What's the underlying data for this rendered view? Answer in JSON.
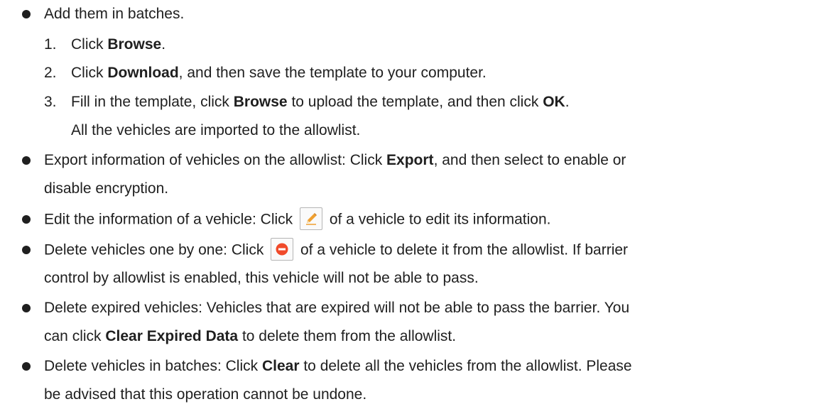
{
  "section": {
    "batch": {
      "intro": "Add them in batches.",
      "steps": [
        {
          "num": "1.",
          "pre": "Click ",
          "bold": "Browse",
          "post": "."
        },
        {
          "num": "2.",
          "pre": "Click ",
          "bold": "Download",
          "post": ", and then save the template to your computer."
        },
        {
          "num": "3.",
          "pre": "Fill in the template, click ",
          "bold": "Browse",
          "mid": " to upload the template, and then click ",
          "bold2": "OK",
          "post": "."
        }
      ],
      "step3_result": "All the vehicles are imported to the allowlist."
    },
    "export": {
      "pre": "Export information of vehicles on the allowlist: Click ",
      "bold": "Export",
      "post": ", and then select to enable or",
      "cont": "disable encryption."
    },
    "edit": {
      "pre": "Edit the information of a vehicle: Click ",
      "icon": "pencil-icon",
      "post": " of a vehicle to edit its information."
    },
    "delete_one": {
      "pre": "Delete vehicles one by one: Click ",
      "icon": "delete-icon",
      "post": " of a vehicle to delete it from the allowlist. If barrier",
      "cont": "control by allowlist is enabled, this vehicle will not be able to pass."
    },
    "delete_expired": {
      "line1": "Delete expired vehicles: Vehicles that are expired will not be able to pass the barrier. You",
      "pre": "can click ",
      "bold": "Clear Expired Data",
      "post": " to delete them from the allowlist."
    },
    "delete_batch": {
      "pre": "Delete vehicles in batches: Click ",
      "bold": "Clear",
      "post": " to delete all the vehicles from the allowlist. Please",
      "cont": "be advised that this operation cannot be undone."
    }
  },
  "colors": {
    "text": "#1f1f1f",
    "pencil": "#f0a030",
    "delete": "#f04a2a",
    "icon_border": "#b5b5b5"
  }
}
